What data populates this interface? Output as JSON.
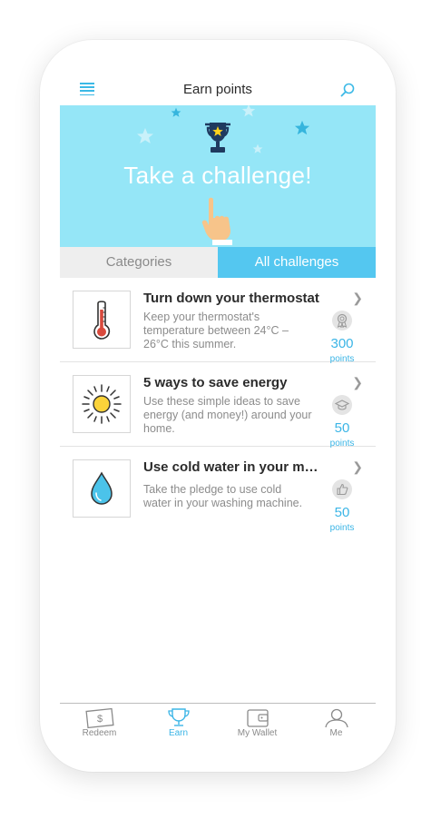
{
  "header": {
    "title": "Earn points"
  },
  "banner": {
    "text": "Take a challenge!"
  },
  "tabs": [
    {
      "label": "Categories",
      "active": false
    },
    {
      "label": "All challenges",
      "active": true
    }
  ],
  "challenges": [
    {
      "title": "Turn down your thermostat",
      "desc": "Keep your thermostat's temperature between 24°C – 26°C this summer.",
      "badge": "ribbon-icon",
      "points": "300",
      "points_label": "points"
    },
    {
      "title": "5 ways to save energy",
      "desc": "Use these simple ideas to save energy (and money!) around your home.",
      "badge": "graduation-cap-icon",
      "points": "50",
      "points_label": "points"
    },
    {
      "title": "Use cold water in your m…",
      "desc": "Take the pledge to use cold water in your washing machine.",
      "badge": "thumbs-up-icon",
      "points": "50",
      "points_label": "points"
    }
  ],
  "nav": [
    {
      "label": "Redeem",
      "icon": "dollar-bill-icon",
      "active": false
    },
    {
      "label": "Earn",
      "icon": "trophy-icon",
      "active": true
    },
    {
      "label": "My Wallet",
      "icon": "wallet-icon",
      "active": false
    },
    {
      "label": "Me",
      "icon": "person-icon",
      "active": false
    }
  ],
  "colors": {
    "accent": "#54c7f0",
    "banner": "#95e6f7",
    "trophy": "#1f3a5f",
    "star": "#ffd21c"
  }
}
